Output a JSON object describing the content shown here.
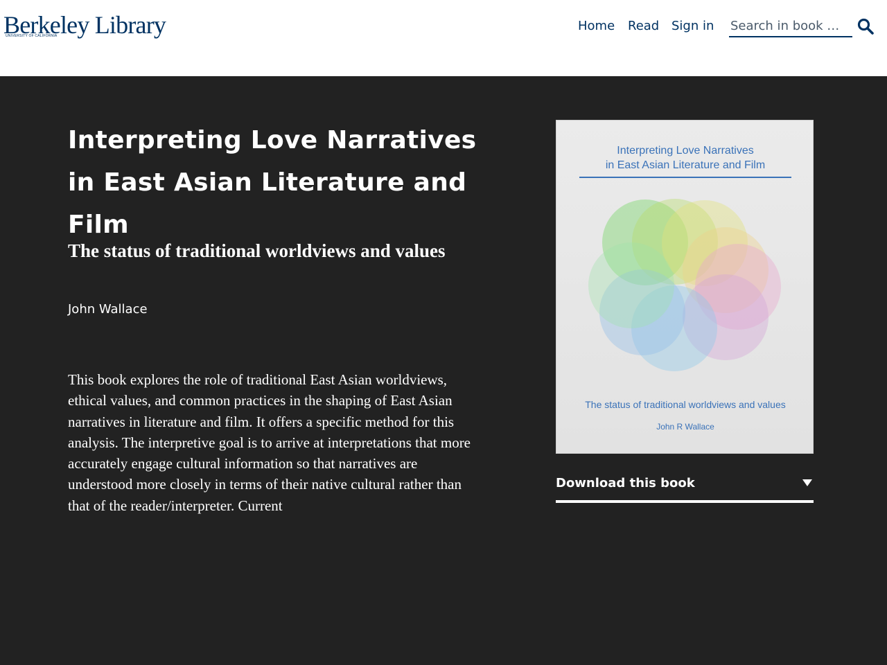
{
  "header": {
    "logo": {
      "main": "Berkeley Library",
      "sub": "UNIVERSITY OF CALIFORNIA"
    },
    "nav": [
      {
        "label": "Home"
      },
      {
        "label": "Read"
      },
      {
        "label": "Sign in"
      }
    ],
    "search": {
      "placeholder": "Search in book …",
      "value": "",
      "icon": "search-icon"
    }
  },
  "book": {
    "title": "Interpreting Love Narratives in East Asian Literature and Film",
    "subtitle": "The status of traditional worldviews and values",
    "author": "John Wallace",
    "description": "This book explores the role of traditional East Asian worldviews, ethical values, and common practices in the shaping of East Asian narratives in literature and film. It offers a specific method for this analysis. The interpretive goal is to arrive at interpretations that more accurately engage cultural information so that narratives are understood more closely in terms of their native cultural rather than that of the reader/interpreter. Current"
  },
  "cover": {
    "title_line1": "Interpreting Love Narratives",
    "title_line2": "in East Asian Literature and Film",
    "subtitle": "The status of traditional worldviews and values",
    "author": "John R Wallace"
  },
  "download": {
    "label": "Download this book",
    "icon": "caret-down-icon"
  },
  "colors": {
    "brand": "#003262",
    "background": "#222222",
    "cover_text": "#3a72b8",
    "text": "#ffffff"
  }
}
